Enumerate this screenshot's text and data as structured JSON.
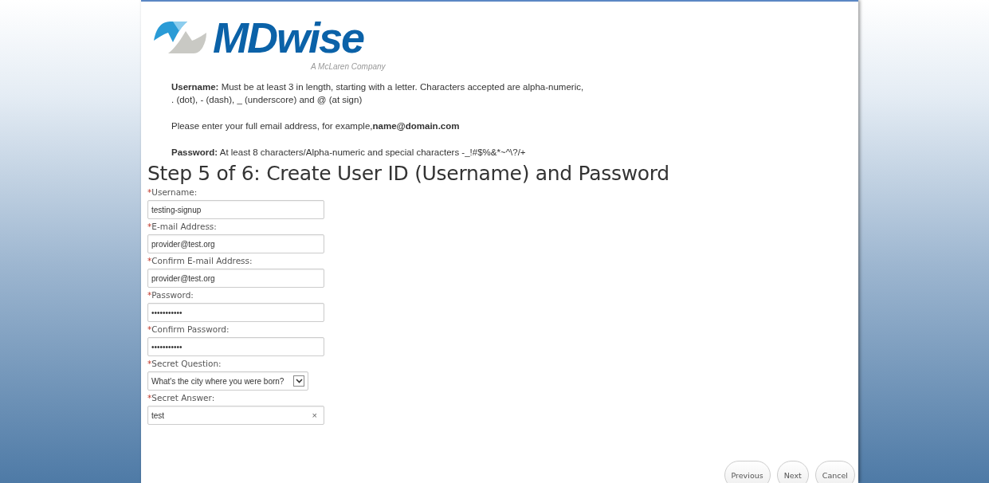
{
  "logo": {
    "name": "MDwise",
    "tagline": "A McLaren Company"
  },
  "instructions": [
    {
      "text": "**Username:** Must be at least 3 in length, starting with a letter. Characters accepted are alpha-numeric,\n. (dot), - (dash), _ (underscore) and @ (at sign)"
    },
    {
      "text": "Please enter your full email address, for example,**name@domain.com**"
    },
    {
      "text": "**Password:** At least 8 characters/Alpha-numeric and special characters -_!#$%&*~^\\?/+"
    }
  ],
  "title": "Step 5 of 6: Create User ID (Username) and Password",
  "fields": [
    {
      "kind": "text",
      "marker": "*",
      "label": "Username:",
      "value": "testing-signup"
    },
    {
      "kind": "text",
      "marker": "*",
      "label": "E-mail Address:",
      "value": "provider@test.org"
    },
    {
      "kind": "text",
      "marker": "*",
      "label": "Confirm E-mail Address:",
      "value": "provider@test.org"
    },
    {
      "kind": "text",
      "marker": "*",
      "label": "Password:",
      "value": "•••••••••••"
    },
    {
      "kind": "text",
      "marker": "*",
      "label": "Confirm Password:",
      "value": "•••••••••••"
    },
    {
      "kind": "select",
      "marker": "*",
      "label": "Secret Question:",
      "value": "What's the city where you were born?"
    },
    {
      "kind": "clearable",
      "marker": "*",
      "label": "Secret Answer:",
      "value": "test",
      "clear": "×"
    }
  ],
  "buttons": [
    "Previous",
    "Next",
    "Cancel"
  ]
}
